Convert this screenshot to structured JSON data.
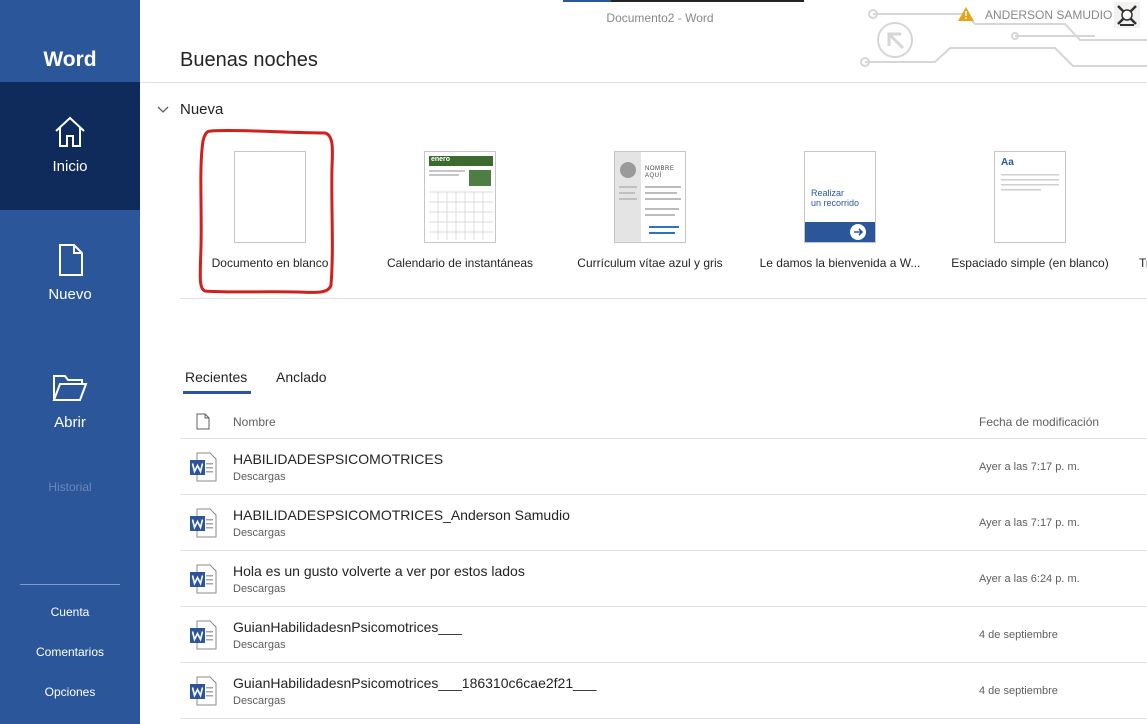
{
  "window": {
    "document_title": "Documento2  -  Word",
    "user_name": "ANDERSON SAMUDIO"
  },
  "sidebar": {
    "brand": "Word",
    "items": [
      {
        "label": "Inicio",
        "icon": "home-icon",
        "active": true
      },
      {
        "label": "Nuevo",
        "icon": "new-document-icon",
        "active": false
      },
      {
        "label": "Abrir",
        "icon": "open-folder-icon",
        "active": false
      }
    ],
    "disabled_item": "Historial",
    "footer": [
      "Cuenta",
      "Comentarios",
      "Opciones"
    ]
  },
  "main": {
    "greeting": "Buenas noches",
    "new_section": {
      "label": "Nueva",
      "templates": [
        {
          "caption": "Documento en blanco"
        },
        {
          "caption": "Calendario de instantáneas",
          "thumb_text": "enero"
        },
        {
          "caption": "Currículum vítae azul y gris",
          "thumb_text_1": "NOMBRE",
          "thumb_text_2": "AQUÍ"
        },
        {
          "caption": "Le damos la bienvenida a W...",
          "thumb_text_1": "Realizar",
          "thumb_text_2": "un recorrido"
        },
        {
          "caption": "Espaciado simple (en blanco)",
          "thumb_text": "Aa"
        },
        {
          "caption": "Tr"
        }
      ]
    },
    "tabs": [
      "Recientes",
      "Anclado"
    ],
    "table": {
      "col_name": "Nombre",
      "col_date": "Fecha de modificación",
      "rows": [
        {
          "name": "HABILIDADESPSICOMOTRICES",
          "location": "Descargas",
          "date": "Ayer a las 7:17 p. m."
        },
        {
          "name": "HABILIDADESPSICOMOTRICES_Anderson Samudio",
          "location": "Descargas",
          "date": "Ayer a las 7:17 p. m."
        },
        {
          "name": "Hola es un gusto volverte a ver por estos lados",
          "location": "Descargas",
          "date": "Ayer a las 6:24 p. m."
        },
        {
          "name": "GuianHabilidadesnPsicomotrices___",
          "location": "Descargas",
          "date": "4 de septiembre"
        },
        {
          "name": "GuianHabilidadesnPsicomotrices___186310c6cae2f21___",
          "location": "Descargas",
          "date": "4 de septiembre"
        }
      ]
    }
  },
  "colors": {
    "sidebar": "#2b579a",
    "sidebar_active": "#0f2b5b",
    "highlight_ring": "#d41f1f",
    "word_icon": "#2b579a"
  }
}
